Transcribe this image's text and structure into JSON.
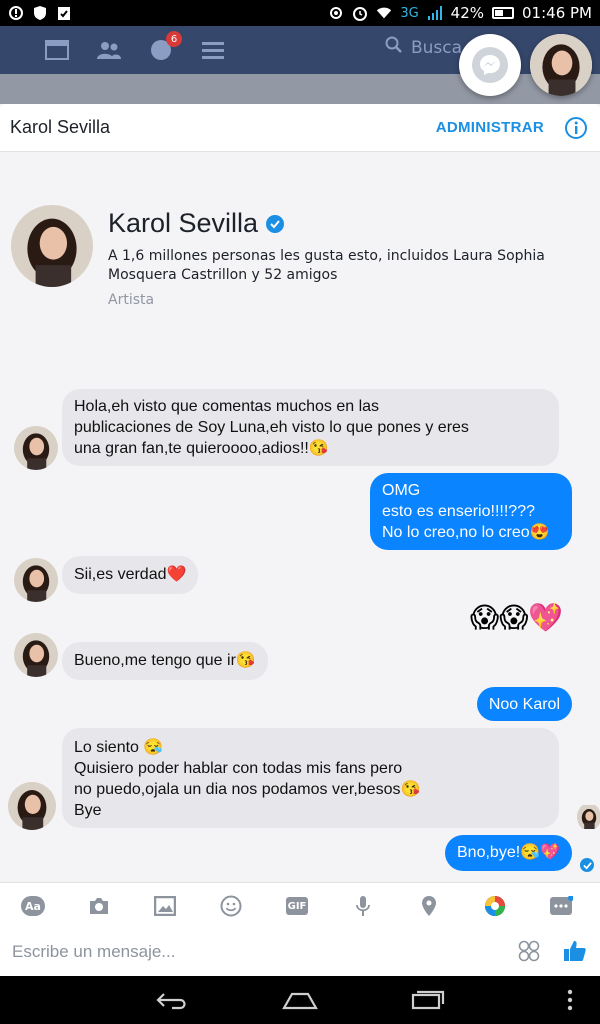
{
  "status_bar": {
    "network": "3G",
    "battery": "42%",
    "time": "01:46 PM"
  },
  "facebook_bar": {
    "notification_count": "6",
    "search_placeholder": "Busca"
  },
  "conversation": {
    "title": "Karol Sevilla",
    "admin_label": "ADMINISTRAR"
  },
  "profile": {
    "name": "Karol Sevilla",
    "likes_text": "A 1,6 millones personas les gusta esto, incluidos Laura Sophia Mosquera Castrillon y 52 amigos",
    "category": "Artista"
  },
  "messages": [
    {
      "from": "them",
      "text": "Hola,eh visto que comentas muchos en las\npublicaciones de Soy Luna,eh visto lo que pones y eres\nuna gran fan,te quieroooo,adios!!😘"
    },
    {
      "from": "me",
      "text": "OMG\nesto es enserio!!!!???\nNo lo creo,no lo creo😍"
    },
    {
      "from": "them",
      "text": "Sii,es verdad❤️"
    },
    {
      "from": "me",
      "text": "😱😱💖"
    },
    {
      "from": "them",
      "text": "Bueno,me tengo que ir😘"
    },
    {
      "from": "me",
      "text": "Noo Karol"
    },
    {
      "from": "them",
      "text": "Lo siento 😪\nQuisiero poder hablar con todas mis fans pero\nno puedo,ojala un dia nos podamos ver,besos😘\nBye"
    },
    {
      "from": "me",
      "text": "Bno,bye!😪💖"
    }
  ],
  "composer": {
    "placeholder": "Escribe un mensaje...",
    "toolbar_icons": [
      "text-format-icon",
      "camera-icon",
      "image-icon",
      "emoji-icon",
      "gif-icon",
      "microphone-icon",
      "location-icon",
      "color-palette-icon",
      "more-icon"
    ],
    "gif_label": "GIF",
    "aa_label": "Aa"
  },
  "colors": {
    "accent": "#0a84ff",
    "incoming_bubble": "#e7e7eb",
    "facebook_bar": "#35476b"
  }
}
